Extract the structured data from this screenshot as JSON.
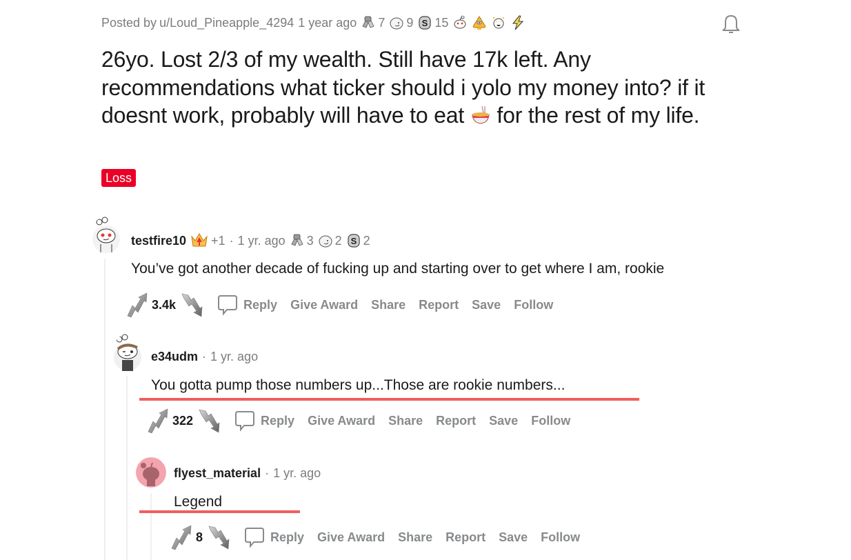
{
  "post": {
    "posted_by_prefix": "Posted by",
    "author": "u/Loud_Pineapple_4294",
    "time": "1 year ago",
    "awards": [
      {
        "icon": "helpful-hands-award-icon",
        "count": "7"
      },
      {
        "icon": "wholesome-seal-award-icon",
        "count": "9"
      },
      {
        "icon": "silver-award-icon",
        "count": "15"
      },
      {
        "icon": "snoo-award-icon",
        "count": ""
      },
      {
        "icon": "pyramid-award-icon",
        "count": ""
      },
      {
        "icon": "starstruck-award-icon",
        "count": ""
      },
      {
        "icon": "lightning-award-icon",
        "count": ""
      }
    ],
    "title_part1": "26yo. Lost 2/3 of my wealth. Still have 17k left. Any recommendations what ticker should i yolo my money into? if it doesnt work, probably will have to eat ",
    "title_emoji": "ramen-emoji",
    "title_part2": " for the rest of my life.",
    "flair": "Loss",
    "flair_color": "#ea0027"
  },
  "comments": [
    {
      "user": "testfire10",
      "badge": "+1",
      "time": "1 yr. ago",
      "awards": [
        {
          "icon": "helpful-hands-award-icon",
          "count": "3"
        },
        {
          "icon": "wholesome-seal-award-icon",
          "count": "2"
        },
        {
          "icon": "silver-award-icon",
          "count": "2"
        }
      ],
      "body": "You’ve got another decade of fucking up and starting over to get where I am, rookie",
      "score": "3.4k"
    },
    {
      "user": "e34udm",
      "time": "1 yr. ago",
      "body": "You gotta pump those numbers up...Those are rookie numbers...",
      "score": "322"
    },
    {
      "user": "flyest_material",
      "time": "1 yr. ago",
      "body": "Legend",
      "score": "8"
    }
  ],
  "actions": {
    "reply": "Reply",
    "give_award": "Give Award",
    "share": "Share",
    "report": "Report",
    "save": "Save",
    "follow": "Follow"
  },
  "separator": "·",
  "highlight_color": "#f25d5d"
}
